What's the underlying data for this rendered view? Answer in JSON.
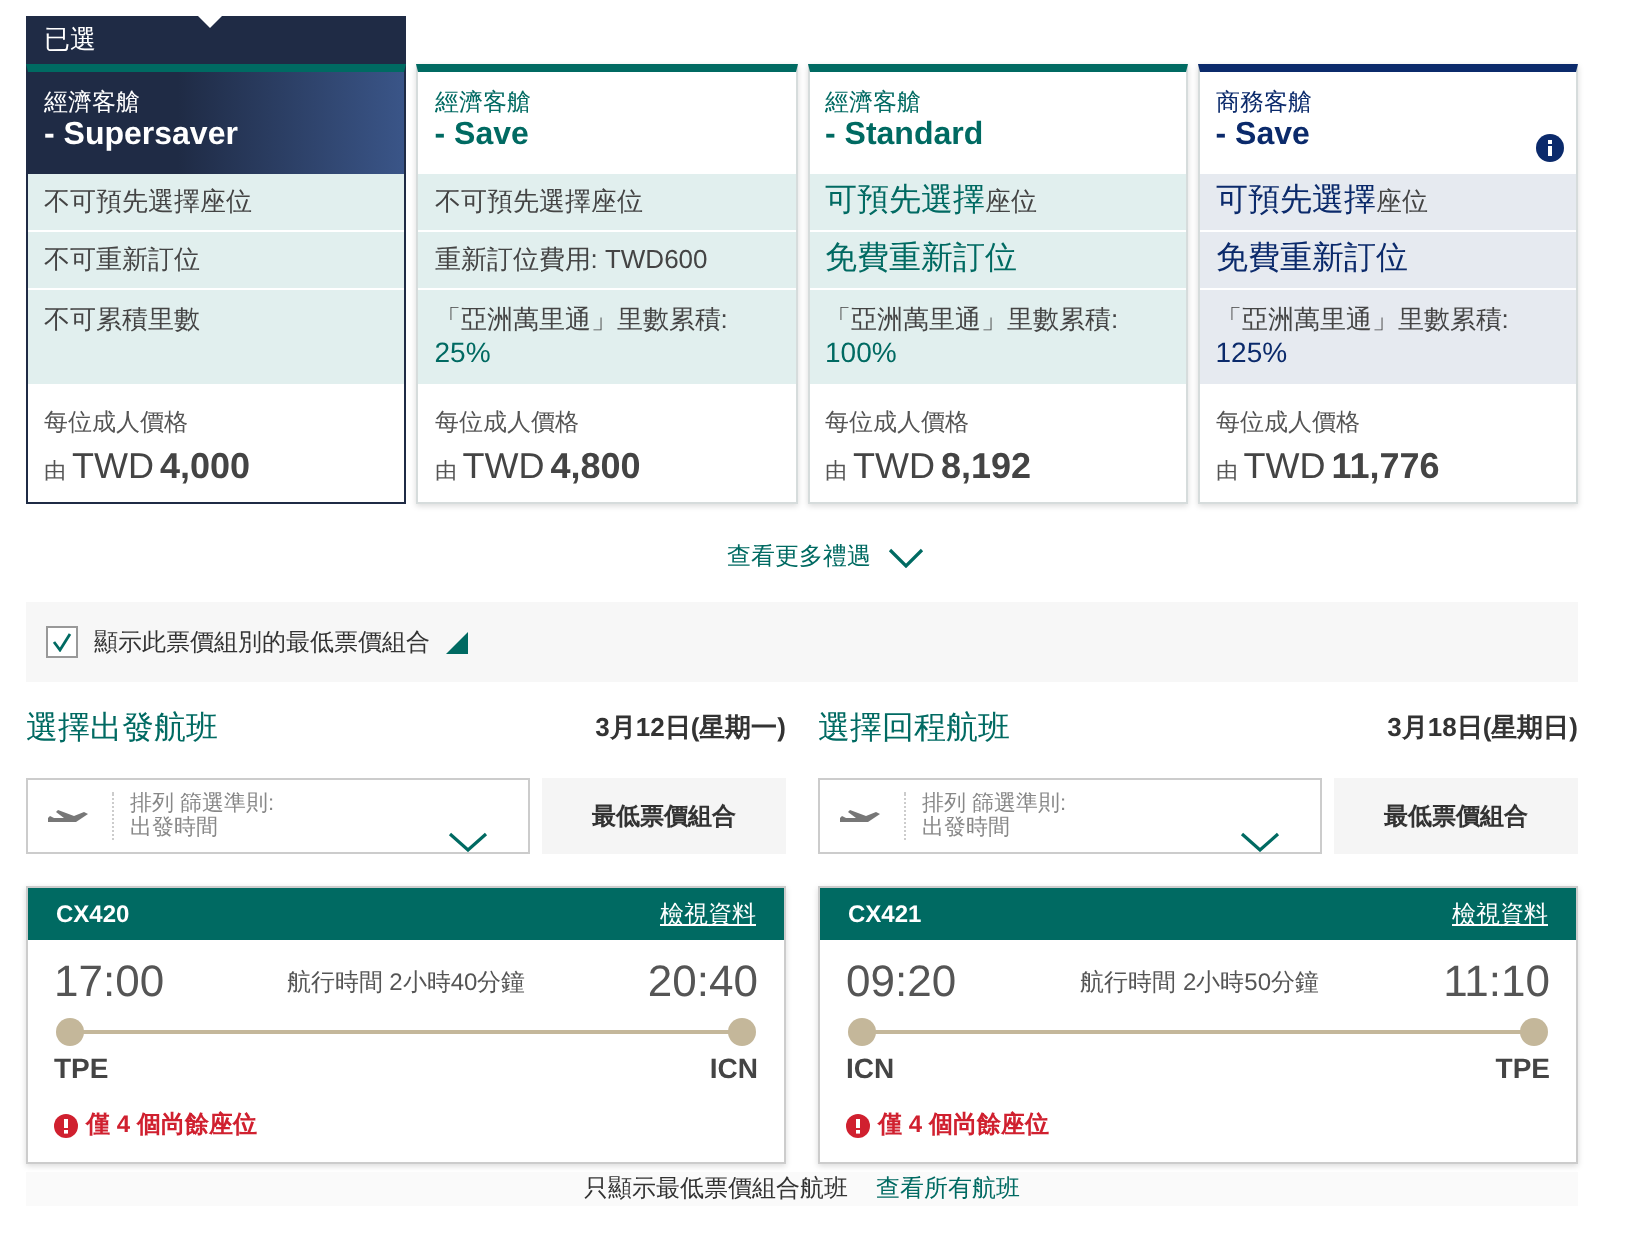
{
  "fares": [
    {
      "selected": true,
      "selected_label": "已選",
      "kind": "economy",
      "cabin_label": "經濟客艙",
      "name": "- Supersaver",
      "info": false,
      "features": [
        {
          "text": "不可預先選擇座位"
        },
        {
          "text": "不可重新訂位"
        },
        {
          "text": "不可累積里數"
        }
      ],
      "price_label": "每位成人價格",
      "from": "由",
      "currency": "TWD",
      "amount": "4,000"
    },
    {
      "selected": false,
      "kind": "economy",
      "cabin_label": "經濟客艙",
      "name": "- Save",
      "info": false,
      "features": [
        {
          "text": "不可預先選擇座位"
        },
        {
          "text": "重新訂位費用: TWD600"
        },
        {
          "text": "「亞洲萬里通」里數累積:",
          "value": "25%"
        }
      ],
      "price_label": "每位成人價格",
      "from": "由",
      "currency": "TWD",
      "amount": "4,800"
    },
    {
      "selected": false,
      "kind": "economy",
      "cabin_label": "經濟客艙",
      "name": "- Standard",
      "info": false,
      "features": [
        {
          "lead": "可預先選擇",
          "text": "座位"
        },
        {
          "lead": "免費重新訂位"
        },
        {
          "text": "「亞洲萬里通」里數累積:",
          "value": "100%"
        }
      ],
      "price_label": "每位成人價格",
      "from": "由",
      "currency": "TWD",
      "amount": "8,192"
    },
    {
      "selected": false,
      "kind": "business",
      "cabin_label": "商務客艙",
      "name": "- Save",
      "info": true,
      "features": [
        {
          "lead": "可預先選擇",
          "text": "座位"
        },
        {
          "lead": "免費重新訂位"
        },
        {
          "text": "「亞洲萬里通」里數累積:",
          "value": "125%"
        }
      ],
      "price_label": "每位成人價格",
      "from": "由",
      "currency": "TWD",
      "amount": "11,776"
    }
  ],
  "more_link": "查看更多禮遇",
  "lowest_fare_option": {
    "label": "顯示此票價組別的最低票價組合",
    "checked": true
  },
  "directions": [
    {
      "title": "選擇出發航班",
      "date": "3月12日(星期一)",
      "sort_label": "排列 篩選準則:",
      "sort_value": "出發時間",
      "lowest_button": "最低票價組合",
      "flight": {
        "code": "CX420",
        "details_link": "檢視資料",
        "depart_time": "17:00",
        "duration": "航行時間 2小時40分鐘",
        "arrive_time": "20:40",
        "origin": "TPE",
        "destination": "ICN",
        "warning": "僅 4 個尚餘座位"
      }
    },
    {
      "title": "選擇回程航班",
      "date": "3月18日(星期日)",
      "sort_label": "排列 篩選準則:",
      "sort_value": "出發時間",
      "lowest_button": "最低票價組合",
      "flight": {
        "code": "CX421",
        "details_link": "檢視資料",
        "depart_time": "09:20",
        "duration": "航行時間 2小時50分鐘",
        "arrive_time": "11:10",
        "origin": "ICN",
        "destination": "TPE",
        "warning": "僅 4 個尚餘座位"
      }
    }
  ],
  "footer": {
    "text": "只顯示最低票價組合航班",
    "link": "查看所有航班"
  }
}
